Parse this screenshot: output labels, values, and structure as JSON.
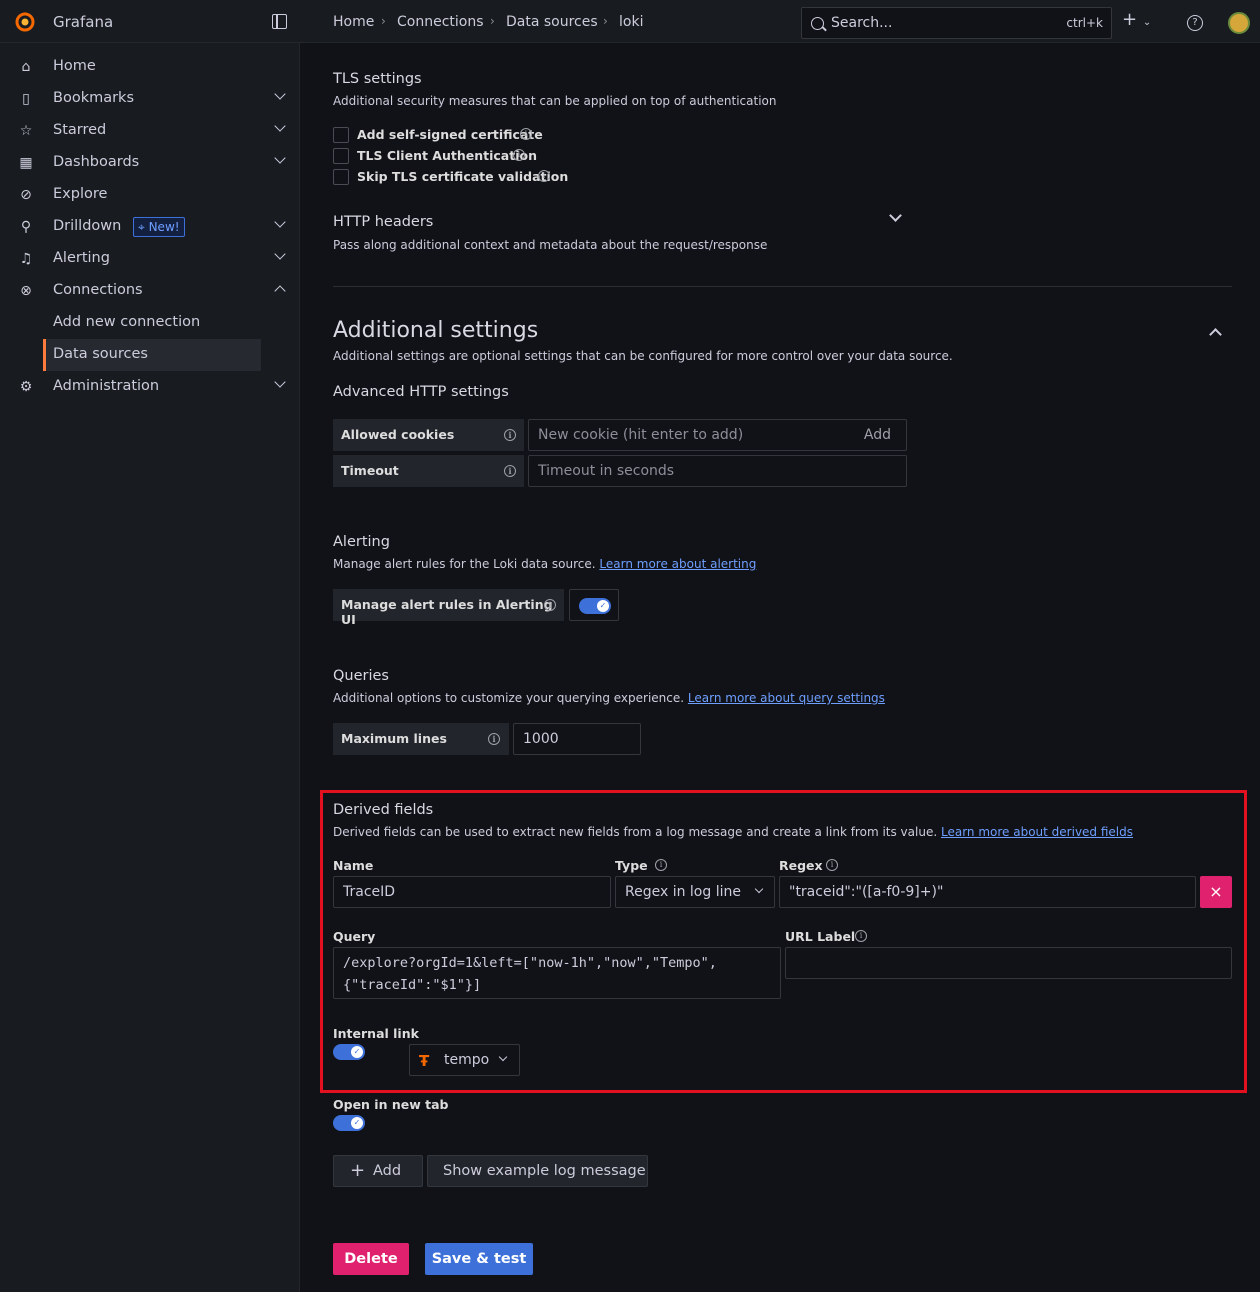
{
  "app": {
    "brand": "Grafana"
  },
  "breadcrumb": [
    "Home",
    "Connections",
    "Data sources",
    "loki"
  ],
  "search": {
    "placeholder": "Search...",
    "shortcut": "ctrl+k"
  },
  "sidebar": {
    "items": [
      {
        "label": "Home",
        "icon": "home-icon"
      },
      {
        "label": "Bookmarks",
        "icon": "bookmark-icon"
      },
      {
        "label": "Starred",
        "icon": "star-icon"
      },
      {
        "label": "Dashboards",
        "icon": "apps-icon"
      },
      {
        "label": "Explore",
        "icon": "compass-icon"
      },
      {
        "label": "Drilldown",
        "icon": "drilldown-icon",
        "badge": "New!"
      },
      {
        "label": "Alerting",
        "icon": "bell-icon"
      },
      {
        "label": "Connections",
        "icon": "connections-icon"
      },
      {
        "label": "Add new connection"
      },
      {
        "label": "Data sources"
      },
      {
        "label": "Administration",
        "icon": "cog-icon"
      }
    ]
  },
  "tls": {
    "title": "TLS settings",
    "desc": "Additional security measures that can be applied on top of authentication",
    "options": [
      "Add self-signed certificate",
      "TLS Client Authentication",
      "Skip TLS certificate validation"
    ]
  },
  "http_headers": {
    "title": "HTTP headers",
    "desc": "Pass along additional context and metadata about the request/response"
  },
  "additional": {
    "title": "Additional settings",
    "desc": "Additional settings are optional settings that can be configured for more control over your data source.",
    "advanced_title": "Advanced HTTP settings",
    "cookies_label": "Allowed cookies",
    "cookies_placeholder": "New cookie (hit enter to add)",
    "cookies_add": "Add",
    "timeout_label": "Timeout",
    "timeout_placeholder": "Timeout in seconds"
  },
  "alerting": {
    "title": "Alerting",
    "desc": "Manage alert rules for the Loki data source.",
    "link": "Learn more about alerting",
    "toggle_label": "Manage alert rules in Alerting UI",
    "toggle_on": true
  },
  "queries": {
    "title": "Queries",
    "desc": "Additional options to customize your querying experience.",
    "link": "Learn more about query settings",
    "max_lines_label": "Maximum lines",
    "max_lines_value": "1000"
  },
  "derived": {
    "title": "Derived fields",
    "desc": "Derived fields can be used to extract new fields from a log message and create a link from its value.",
    "link": "Learn more about derived fields",
    "name_label": "Name",
    "name_value": "TraceID",
    "type_label": "Type",
    "type_value": "Regex in log line",
    "regex_label": "Regex",
    "regex_value": "\"traceid\":\"([a-f0-9]+)\"",
    "query_label": "Query",
    "query_line1": "/explore?orgId=1&left=[\"now-1h\",\"now\",\"Tempo\",",
    "query_line2": "{\"traceId\":\"$1\"}]",
    "url_label": "URL Label",
    "url_value": "",
    "internal_link_label": "Internal link",
    "internal_link_on": true,
    "datasource": "tempo",
    "open_new_tab_label": "Open in new tab",
    "open_new_tab_on": true
  },
  "actions": {
    "add": "Add",
    "show_example": "Show example log message",
    "delete": "Delete",
    "save": "Save & test"
  },
  "colors": {
    "accent": "#3d71d9",
    "danger": "#e0226e",
    "highlight": "#e3101f",
    "active_nav": "#ff7a3d"
  }
}
